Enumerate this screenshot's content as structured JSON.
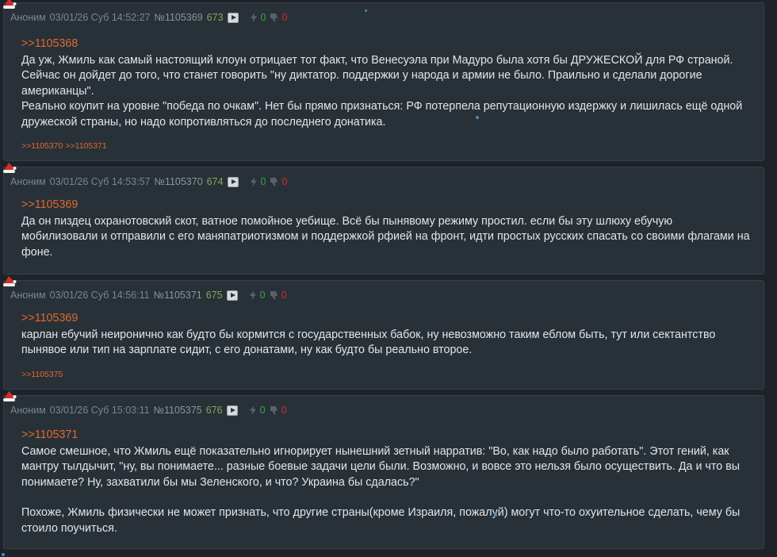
{
  "posts": [
    {
      "name": "Аноним",
      "date": "03/01/26 Суб 14:52:27",
      "num": "№1105369",
      "ord": "673",
      "likes": "0",
      "dislikes": "0",
      "reply_to": ">>1105368",
      "paragraphs": [
        "Да уж, Жмиль как самый настоящий клоун отрицает тот факт, что Венесуэла при Мадуро была хотя бы ДРУЖЕСКОЙ для РФ страной. Сейчас он дойдет до того, что станет говорить \"ну диктатор. поддержки у народа и армии не было. Праильно и сделали дорогие американцы\".",
        "Реально коупит на уровне \"победа по очкам\". Нет бы прямо признаться: РФ потерпела репутационную издержку и лишилась ещё одной дружеской страны, но надо копротивляться до последнего донатика."
      ],
      "refs": [
        ">>1105370",
        ">>1105371"
      ]
    },
    {
      "name": "Аноним",
      "date": "03/01/26 Суб 14:53:57",
      "num": "№1105370",
      "ord": "674",
      "likes": "0",
      "dislikes": "0",
      "reply_to": ">>1105369",
      "paragraphs": [
        "Да он пиздец охранотовский скот, ватное помойное уебище. Всё бы пынявому режиму простил. если бы эту шлюху ебучую мобилизовали и отправили с его маняпатриотизмом и поддержкой рфией на фронт, идти простых русских спасать со своими флагами на фоне."
      ],
      "refs": []
    },
    {
      "name": "Аноним",
      "date": "03/01/26 Суб 14:56:11",
      "num": "№1105371",
      "ord": "675",
      "likes": "0",
      "dislikes": "0",
      "reply_to": ">>1105369",
      "paragraphs": [
        "карлан ебучий неиронично как будто бы кормится с государственных бабок, ну невозможно таким еблом быть, тут или сектантство пынявое или тип на зарплате сидит, с его донатами, ну как будто бы реально второе."
      ],
      "refs": [
        ">>1105375"
      ]
    },
    {
      "name": "Аноним",
      "date": "03/01/26 Суб 15:03:11",
      "num": "№1105375",
      "ord": "676",
      "likes": "0",
      "dislikes": "0",
      "reply_to": ">>1105371",
      "paragraphs": [
        "Самое смешное, что Жмиль ещё показательно игнорирует нынешний зетный нарратив: \"Во, как надо было работать\". Этот гений, как мантру тылдычит, \"ну, вы понимаете... разные боевые задачи цели были. Возможно, и вовсе это нельзя было осуществить. Да и что вы понимаете? Ну, захватили бы мы Зеленского, и что? Украина бы сдалась?\"",
        "Похоже, Жмиль физически не может признать, что другие страны(кроме Израиля, пожалуй) могут что-то охуительное сделать, чему бы стоило поучиться."
      ],
      "refs": []
    }
  ],
  "colors": {
    "background": "#1f2329",
    "post_bg": "#283138",
    "reply_link": "#e06a2c",
    "likes": "#3ea33e",
    "dislikes": "#d52c2c",
    "ordinal": "#8aa25a"
  },
  "icons": [
    "santa-hat-icon",
    "play-icon",
    "lightning-icon",
    "thumbs-down-icon"
  ]
}
